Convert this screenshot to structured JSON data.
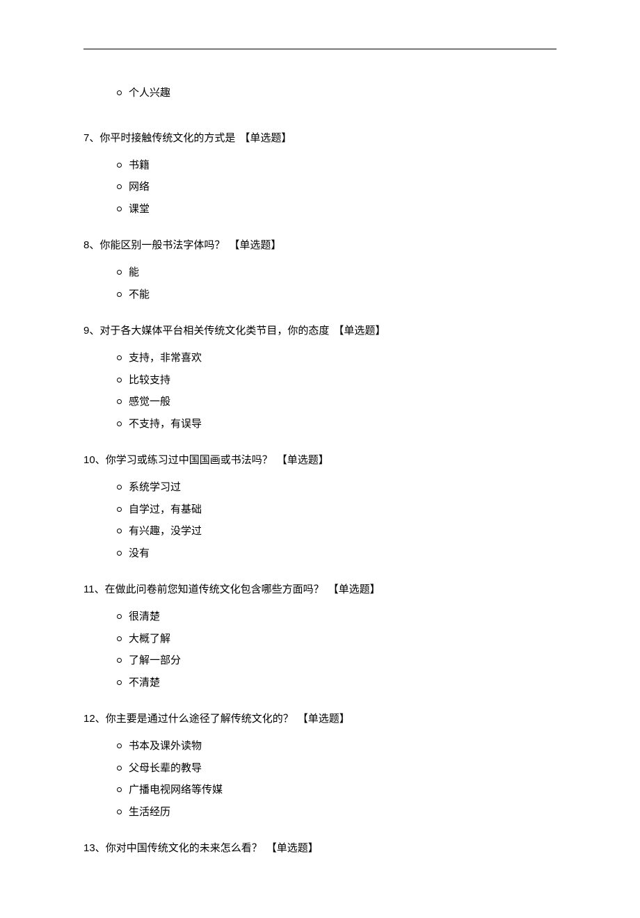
{
  "orphan": {
    "option": "个人兴趣"
  },
  "questions": [
    {
      "number": "7、",
      "text": "你平时接触传统文化的方式是",
      "type": "【单选题】",
      "options": [
        "书籍",
        "网络",
        "课堂"
      ]
    },
    {
      "number": "8、",
      "text": "你能区别一般书法字体吗？",
      "type": "【单选题】",
      "options": [
        "能",
        "不能"
      ]
    },
    {
      "number": "9、",
      "text": "对于各大媒体平台相关传统文化类节目，你的态度",
      "type": "【单选题】",
      "options": [
        "支持，非常喜欢",
        "比较支持",
        "感觉一般",
        "不支持，有误导"
      ]
    },
    {
      "number": "10、",
      "text": "你学习或练习过中国国画或书法吗？",
      "type": "【单选题】",
      "options": [
        "系统学习过",
        "自学过，有基础",
        "有兴趣，没学过",
        "没有"
      ]
    },
    {
      "number": "11、",
      "text": "在做此问卷前您知道传统文化包含哪些方面吗？",
      "type": "【单选题】",
      "options": [
        "很清楚",
        "大概了解",
        "了解一部分",
        "不清楚"
      ]
    },
    {
      "number": "12、",
      "text": "你主要是通过什么途径了解传统文化的？",
      "type": "【单选题】",
      "options": [
        "书本及课外读物",
        "父母长辈的教导",
        "广播电视网络等传媒",
        "生活经历"
      ]
    },
    {
      "number": "13、",
      "text": "你对中国传统文化的未来怎么看？",
      "type": "【单选题】",
      "options": []
    }
  ]
}
